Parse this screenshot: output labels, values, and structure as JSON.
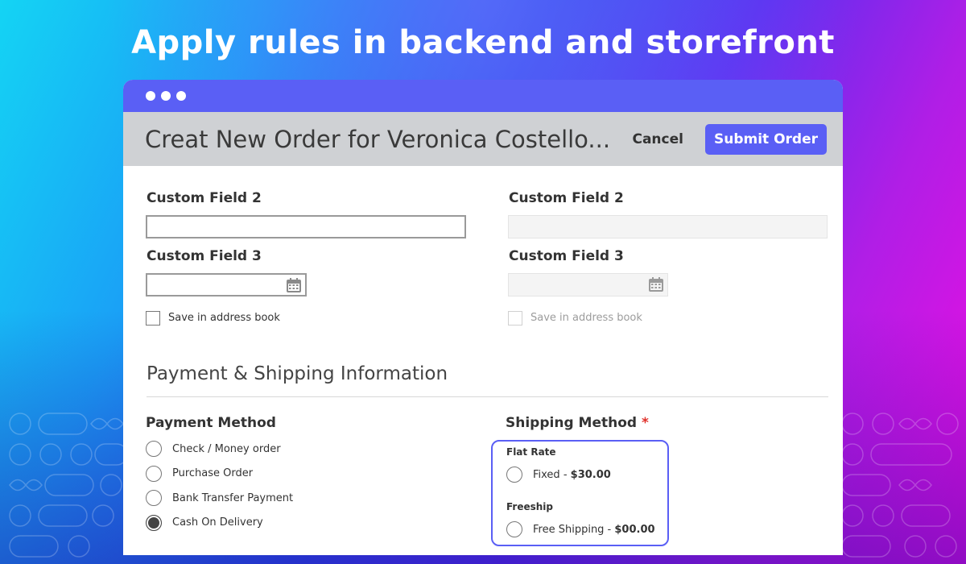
{
  "headline": "Apply rules in backend and storefront",
  "window": {
    "title": "Creat New Order for Veronica Costello...",
    "cancel_label": "Cancel",
    "submit_label": "Submit Order"
  },
  "left_form": {
    "field2_label": "Custom Field 2",
    "field2_value": "",
    "field3_label": "Custom Field 3",
    "field3_value": "",
    "save_label": "Save in address book",
    "save_checked": false
  },
  "right_form": {
    "field2_label": "Custom Field 2",
    "field3_label": "Custom Field 3",
    "save_label": "Save in address book",
    "disabled": true
  },
  "section": {
    "title": "Payment & Shipping Information"
  },
  "payment": {
    "label": "Payment Method",
    "options": [
      {
        "label": "Check / Money order",
        "selected": false
      },
      {
        "label": "Purchase Order",
        "selected": false
      },
      {
        "label": "Bank Transfer Payment",
        "selected": false
      },
      {
        "label": "Cash On Delivery",
        "selected": true
      }
    ]
  },
  "shipping": {
    "label": "Shipping Method",
    "required_mark": "*",
    "groups": [
      {
        "name": "Flat Rate",
        "option": "Fixed - ",
        "price": "$30.00"
      },
      {
        "name": "Freeship",
        "option": "Free Shipping - ",
        "price": "$00.00"
      }
    ]
  },
  "colors": {
    "accent": "#5a5ff5",
    "header_gray": "#cfd1d4",
    "required": "#e0302a"
  }
}
